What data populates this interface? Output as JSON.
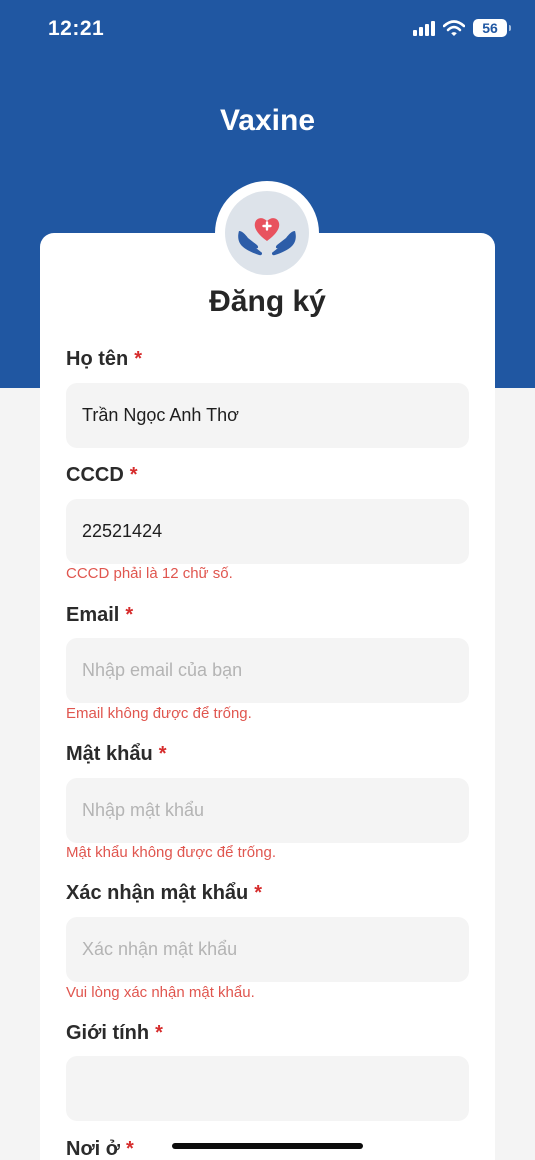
{
  "status_bar": {
    "time": "12:21",
    "battery": "56"
  },
  "app": {
    "title": "Vaxine"
  },
  "form": {
    "title": "Đăng ký",
    "required_mark": "*",
    "fields": [
      {
        "label": "Họ tên",
        "value": "Trần Ngọc Anh Thơ",
        "placeholder": ""
      },
      {
        "label": "CCCD",
        "value": "22521424",
        "placeholder": "",
        "error": "CCCD phải là 12 chữ số."
      },
      {
        "label": "Email",
        "value": "",
        "placeholder": "Nhập email của bạn",
        "error": "Email không được để trống."
      },
      {
        "label": "Mật khẩu",
        "value": "",
        "placeholder": "Nhập mật khẩu",
        "error": "Mật khẩu không được để trống."
      },
      {
        "label": "Xác nhận mật khẩu",
        "value": "",
        "placeholder": "Xác nhận mật khẩu",
        "error": "Vui lòng xác nhận mật khẩu."
      },
      {
        "label": "Giới tính",
        "value": "",
        "placeholder": ""
      },
      {
        "label": "Nơi ở"
      }
    ]
  },
  "colors": {
    "header": "#2057a2",
    "error": "#e0564f",
    "required": "#d62c2c",
    "logo_heart": "#e8525e",
    "logo_hands": "#2d5da8"
  }
}
